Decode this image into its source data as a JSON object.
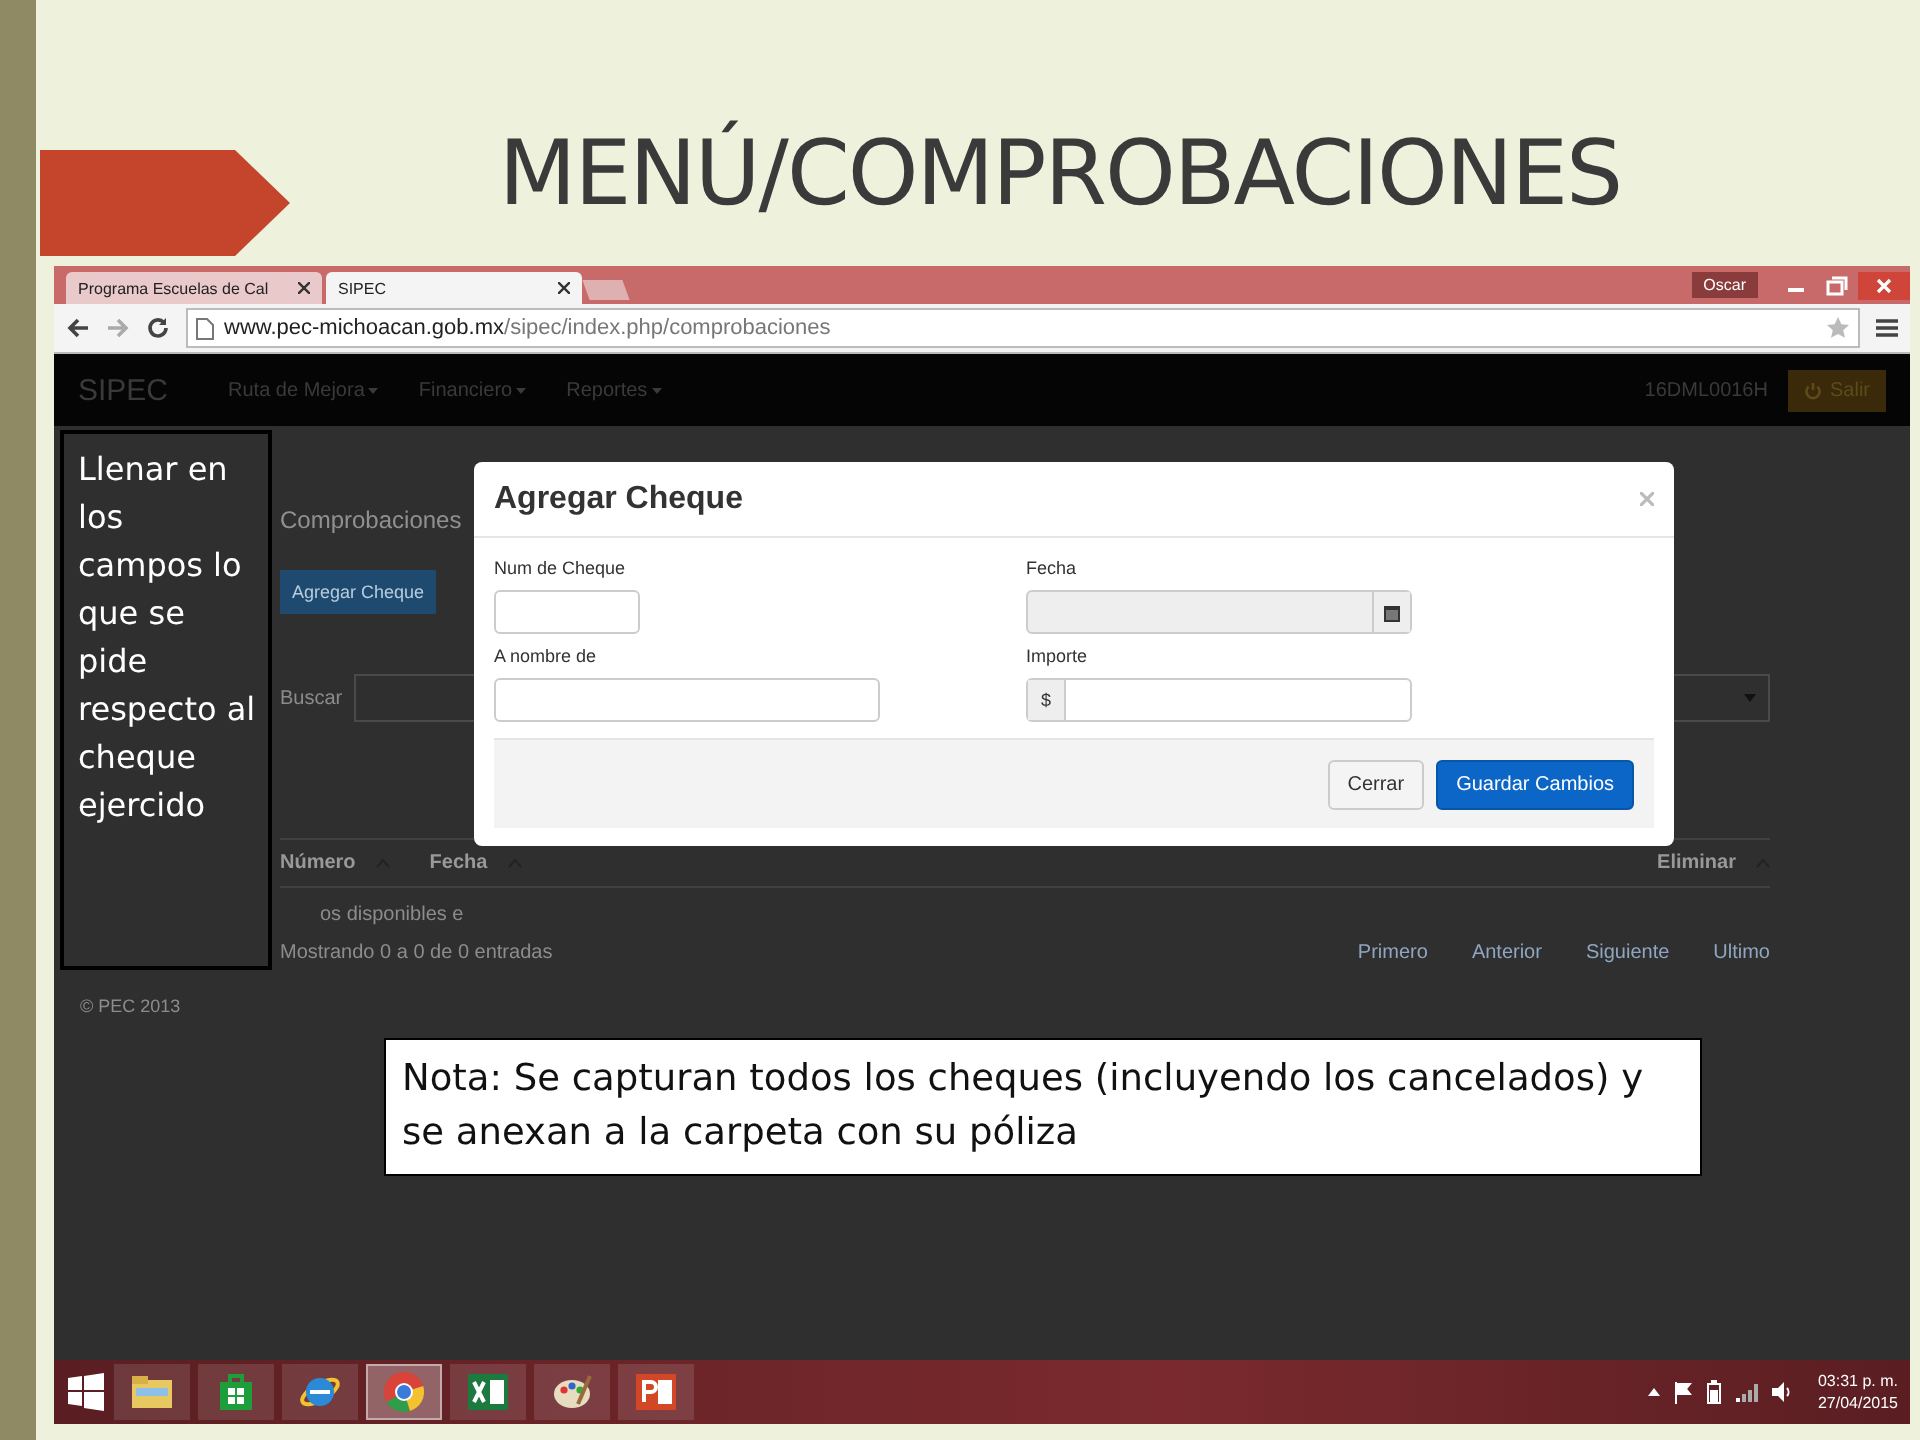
{
  "slide": {
    "title": "MENÚ/COMPROBACIONES"
  },
  "browser": {
    "tabs": [
      {
        "label": "Programa Escuelas de Cal",
        "selected": false
      },
      {
        "label": "SIPEC",
        "selected": true
      }
    ],
    "user": "Oscar",
    "url_host": "www.pec-michoacan.gob.mx",
    "url_path": "/sipec/index.php/comprobaciones"
  },
  "navbar": {
    "brand": "SIPEC",
    "menus": [
      "Ruta de Mejora",
      "Financiero",
      "Reportes"
    ],
    "code": "16DML0016H",
    "logout": "Salir"
  },
  "page": {
    "heading": "Comprobaciones",
    "add_button": "Agregar Cheque",
    "search_label": "Buscar",
    "columns": [
      "Número",
      "Fecha",
      "Eliminar"
    ],
    "empty_message": "os disponibles e",
    "info": "Mostrando 0 a 0 de 0 entradas",
    "pagination": [
      "Primero",
      "Anterior",
      "Siguiente",
      "Ultimo"
    ],
    "footer": "© PEC 2013"
  },
  "modal": {
    "title": "Agregar Cheque",
    "fields": [
      {
        "label": "Num de Cheque",
        "kind": "short"
      },
      {
        "label": "Fecha",
        "kind": "date"
      },
      {
        "label": "A nombre de",
        "kind": "text"
      },
      {
        "label": "Importe",
        "kind": "currency",
        "prefix": "$"
      }
    ],
    "buttons": [
      {
        "label": "Cerrar",
        "kind": "default"
      },
      {
        "label": "Guardar Cambios",
        "kind": "primary"
      }
    ]
  },
  "callout": "Llenar en los campos lo que se pide respecto al cheque ejercido",
  "note": "Nota: Se capturan todos los cheques (incluyendo los cancelados) y se anexan a la carpeta con su póliza",
  "taskbar": {
    "apps": [
      {
        "kind": "explorer",
        "selected": false
      },
      {
        "kind": "store",
        "selected": false
      },
      {
        "kind": "ie",
        "selected": false
      },
      {
        "kind": "chrome",
        "selected": true
      },
      {
        "kind": "excel",
        "selected": false
      },
      {
        "kind": "paint",
        "selected": false
      },
      {
        "kind": "powerpoint",
        "selected": false
      }
    ],
    "time": "03:31 p. m.",
    "date": "27/04/2015"
  }
}
